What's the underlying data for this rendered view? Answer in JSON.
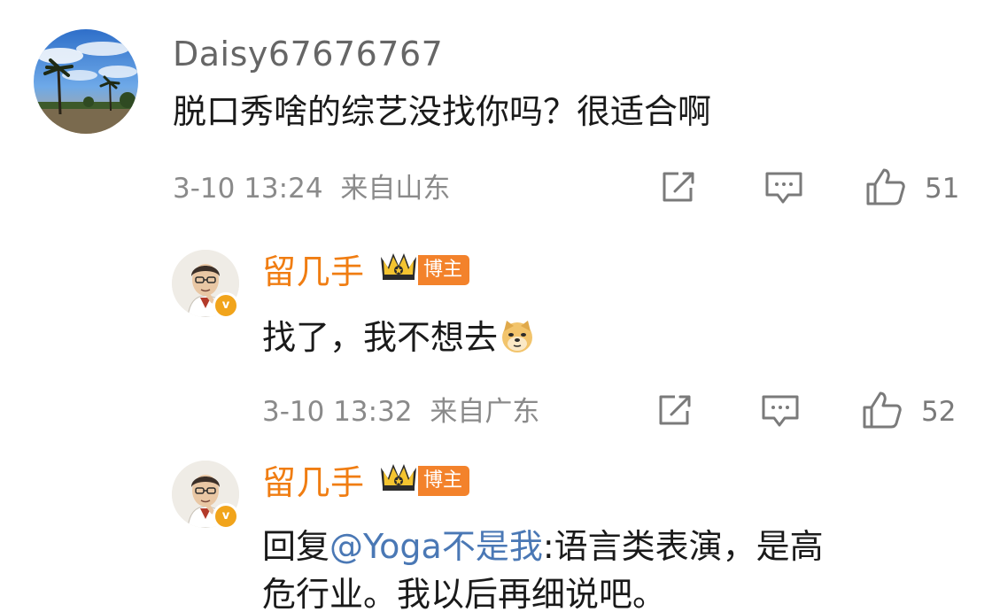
{
  "comments": [
    {
      "username": "Daisy67676767",
      "text": "脱口秀啥的综艺没找你吗？很适合啊",
      "time": "3-10 13:24",
      "location": "来自山东",
      "likes": "51"
    }
  ],
  "replies": [
    {
      "username": "留几手",
      "badge": "博主",
      "text": "找了，我不想去",
      "emoji": "doge-emoji",
      "time": "3-10 13:32",
      "location": "来自广东",
      "likes": "52"
    },
    {
      "username": "留几手",
      "badge": "博主",
      "reply_prefix": "回复",
      "mention": "@Yoga不是我",
      "text_line1": ":语言类表演，是高",
      "text_line2": "危行业。我以后再细说吧。"
    }
  ],
  "icons": [
    "share-icon",
    "comment-icon",
    "like-icon",
    "crown-icon",
    "verified-icon"
  ],
  "colors": {
    "username_blogger": "#f07d12",
    "mention": "#4a78b5",
    "badge_bg": "#f3822b",
    "verified": "#f1a41b"
  }
}
